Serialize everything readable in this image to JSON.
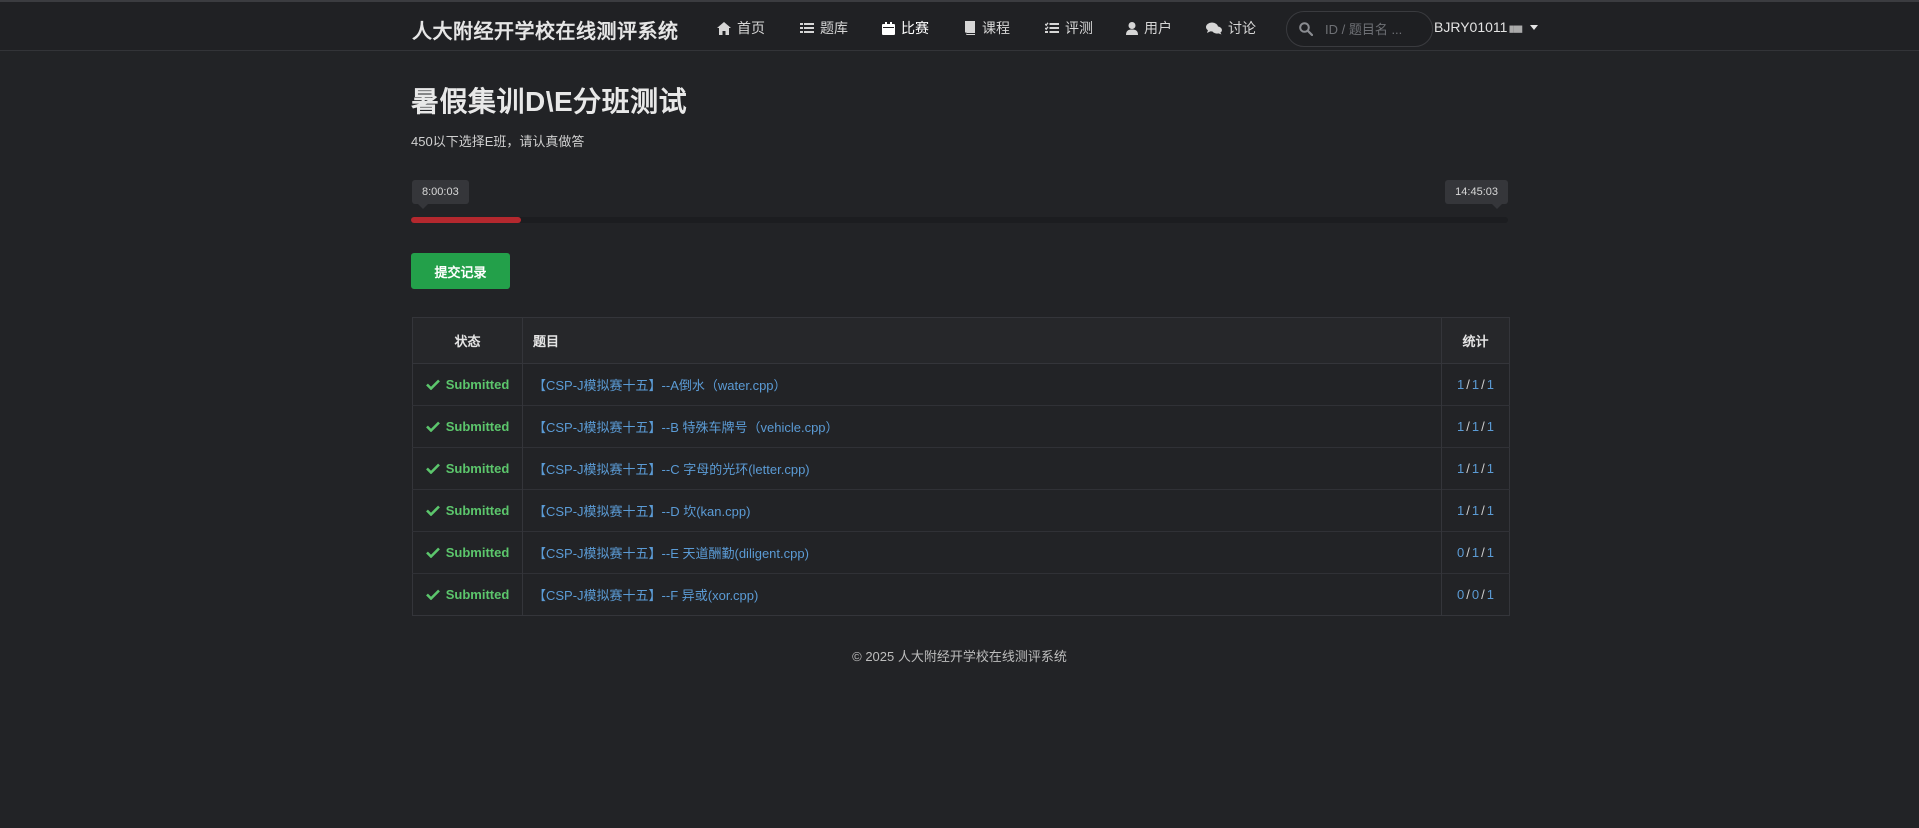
{
  "navbar": {
    "brand": "人大附经开学校在线测评系统",
    "items": [
      {
        "label": "首页",
        "icon": "home-icon"
      },
      {
        "label": "题库",
        "icon": "list-icon"
      },
      {
        "label": "比赛",
        "icon": "calendar-icon"
      },
      {
        "label": "课程",
        "icon": "book-icon"
      },
      {
        "label": "评测",
        "icon": "tasks-icon"
      },
      {
        "label": "用户",
        "icon": "user-icon"
      },
      {
        "label": "讨论",
        "icon": "comments-icon"
      }
    ],
    "active_item": "比赛",
    "search_placeholder": "ID / 题目名 ...",
    "username": "BJRY01011",
    "username_suffix": "███"
  },
  "contest": {
    "title": "暑假集训D\\E分班测试",
    "description": "450以下选择E班，请认真做答",
    "start_time": "8:00:03",
    "end_time": "14:45:03",
    "progress_fraction": 0.1,
    "progress_color": "#b4282e",
    "submit_button_label": "提交记录"
  },
  "table": {
    "headers": {
      "status": "状态",
      "title": "题目",
      "stats": "统计"
    },
    "rows": [
      {
        "status": "Submitted",
        "title": "【CSP-J模拟赛十五】--A倒水（water.cpp）",
        "stats": [
          "1",
          "1",
          "1"
        ]
      },
      {
        "status": "Submitted",
        "title": "【CSP-J模拟赛十五】--B 特殊车牌号（vehicle.cpp）",
        "stats": [
          "1",
          "1",
          "1"
        ]
      },
      {
        "status": "Submitted",
        "title": "【CSP-J模拟赛十五】--C 字母的光环(letter.cpp)",
        "stats": [
          "1",
          "1",
          "1"
        ]
      },
      {
        "status": "Submitted",
        "title": "【CSP-J模拟赛十五】--D 坎(kan.cpp)",
        "stats": [
          "1",
          "1",
          "1"
        ]
      },
      {
        "status": "Submitted",
        "title": "【CSP-J模拟赛十五】--E 天道酬勤(diligent.cpp)",
        "stats": [
          "0",
          "1",
          "1"
        ]
      },
      {
        "status": "Submitted",
        "title": "【CSP-J模拟赛十五】--F 异或(xor.cpp)",
        "stats": [
          "0",
          "0",
          "1"
        ]
      }
    ],
    "status_color": "#5cc66c",
    "link_color": "#5b9bd5"
  },
  "footer": {
    "text": "© 2025 人大附经开学校在线测评系统"
  }
}
